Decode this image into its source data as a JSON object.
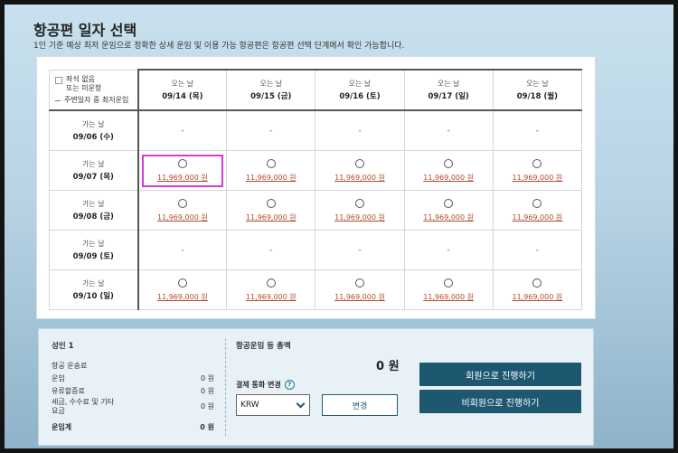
{
  "page": {
    "title": "항공편 일자 선택",
    "subtitle": "1인 기준 예상 최저 운임으로 정확한 상세 운임 및 이용 가능 항공편은 항공편 선택 단계에서 확인 가능합니다."
  },
  "legend": {
    "unavailable": "좌석 없음\n또는 미운항",
    "lowest": "주변일자 중 최저운임"
  },
  "columns": [
    {
      "label": "오는 날",
      "date": "09/14 (목)"
    },
    {
      "label": "오는 날",
      "date": "09/15 (금)"
    },
    {
      "label": "오는 날",
      "date": "09/16 (토)"
    },
    {
      "label": "오는 날",
      "date": "09/17 (일)"
    },
    {
      "label": "오는 날",
      "date": "09/18 (월)"
    }
  ],
  "rows": [
    {
      "label": "가는 날",
      "date": "09/06 (수)",
      "cells": [
        "-",
        "-",
        "-",
        "-",
        "-"
      ]
    },
    {
      "label": "가는 날",
      "date": "09/07 (목)",
      "cells": [
        "11,969,000 원",
        "11,969,000 원",
        "11,969,000 원",
        "11,969,000 원",
        "11,969,000 원"
      ]
    },
    {
      "label": "가는 날",
      "date": "09/08 (금)",
      "cells": [
        "11,969,000 원",
        "11,969,000 원",
        "11,969,000 원",
        "11,969,000 원",
        "11,969,000 원"
      ]
    },
    {
      "label": "가는 날",
      "date": "09/09 (토)",
      "cells": [
        "-",
        "-",
        "-",
        "-",
        "-"
      ]
    },
    {
      "label": "가는 날",
      "date": "09/10 (일)",
      "cells": [
        "11,969,000 원",
        "11,969,000 원",
        "11,969,000 원",
        "11,969,000 원",
        "11,969,000 원"
      ]
    }
  ],
  "summary": {
    "adult": "성인 1",
    "fare_heading": "항공 운송료",
    "items": [
      {
        "label": "운임",
        "value": "0 원"
      },
      {
        "label": "유류할증료",
        "value": "0 원"
      },
      {
        "label": "세금, 수수료 및 기타\n요금",
        "value": "0 원"
      }
    ],
    "total_label": "운임계",
    "total_value": "0 원",
    "grand_heading": "항공운임 등 총액",
    "grand_total": "0 원",
    "currency_label": "결제 통화 변경",
    "currency_value": "KRW",
    "change_button": "변경",
    "member_button": "회원으로 진행하기",
    "guest_button": "비회원으로 진행하기"
  },
  "colors": {
    "price": "#b54a2a",
    "selected_outline": "#d33ad8",
    "button": "#1e5870"
  }
}
